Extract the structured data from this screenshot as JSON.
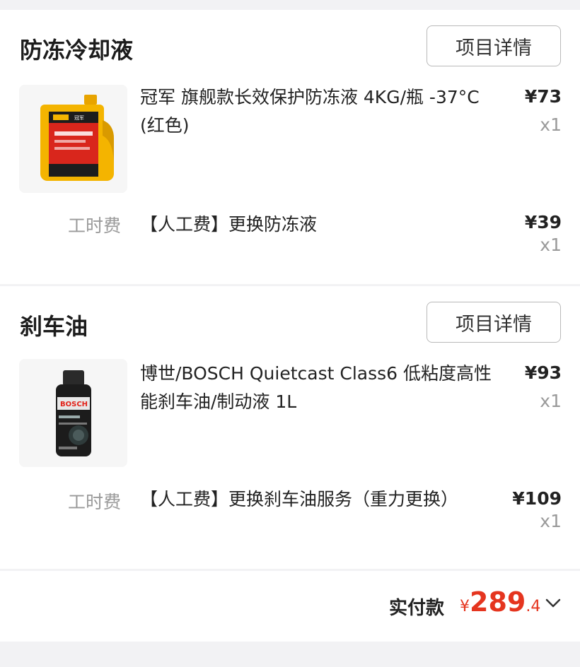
{
  "sections": [
    {
      "title": "防冻冷却液",
      "detail_button": "项目详情",
      "product": {
        "name": "冠军 旗舰款长效保护防冻液 4KG/瓶 -37°C (红色)",
        "price": "¥73",
        "qty": "x1"
      },
      "labor": {
        "label": "工时费",
        "name": "【人工费】更换防冻液",
        "price": "¥39",
        "qty": "x1"
      }
    },
    {
      "title": "刹车油",
      "detail_button": "项目详情",
      "product": {
        "name": "博世/BOSCH Quietcast Class6 低粘度高性能刹车油/制动液 1L",
        "price": "¥93",
        "qty": "x1"
      },
      "labor": {
        "label": "工时费",
        "name": "【人工费】更换刹车油服务（重力更换）",
        "price": "¥109",
        "qty": "x1"
      }
    }
  ],
  "footer": {
    "label": "实付款",
    "currency": "¥",
    "amount_int": "289",
    "amount_dec": ".4"
  },
  "colors": {
    "accent": "#e5351f",
    "muted": "#9a9a9a",
    "background": "#f2f2f4"
  },
  "icons": [
    "chevron-down-icon"
  ]
}
